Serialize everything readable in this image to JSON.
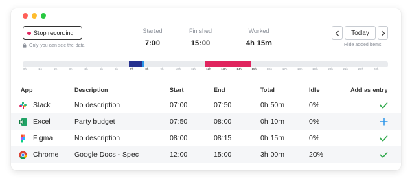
{
  "window_controls": [
    "close",
    "minimize",
    "maximize"
  ],
  "recording": {
    "stop_label": "Stop recording",
    "private_note": "Only you can see the data"
  },
  "stats": {
    "started": {
      "label": "Started",
      "value": "7:00"
    },
    "finished": {
      "label": "Finished",
      "value": "15:00"
    },
    "worked": {
      "label": "Worked",
      "value": "4h 15m"
    }
  },
  "date_nav": {
    "prev_icon": "chevron-left-icon",
    "today_label": "Today",
    "next_icon": "chevron-right-icon",
    "hide_added_label": "Hide added items"
  },
  "timeline": {
    "range_hours": [
      0,
      24
    ],
    "ticks": [
      "0h",
      "1h",
      "2h",
      "3h",
      "4h",
      "5h",
      "6h",
      "7h",
      "8h",
      "9h",
      "10h",
      "11h",
      "12h",
      "13h",
      "14h",
      "15h",
      "16h",
      "17h",
      "18h",
      "19h",
      "20h",
      "21h",
      "22h",
      "23h"
    ],
    "active_ticks": [
      "7h",
      "8h",
      "12h",
      "13h",
      "14h",
      "15h"
    ],
    "segments": [
      {
        "start_hour": 7.0,
        "end_hour": 7.83,
        "color": "#26318f"
      },
      {
        "start_hour": 7.83,
        "end_hour": 8.0,
        "color": "#2b95e9"
      },
      {
        "start_hour": 12.0,
        "end_hour": 15.0,
        "color": "#e0245e"
      }
    ]
  },
  "table": {
    "headers": {
      "app": "App",
      "description": "Description",
      "start": "Start",
      "end": "End",
      "total": "Total",
      "idle": "Idle",
      "add": "Add as entry"
    },
    "rows": [
      {
        "app": "Slack",
        "icon": "slack-icon",
        "description": "No description",
        "start": "07:00",
        "end": "07:50",
        "total": "0h 50m",
        "idle": "0%",
        "action": "check-icon"
      },
      {
        "app": "Excel",
        "icon": "excel-icon",
        "description": "Party budget",
        "start": "07:50",
        "end": "08:00",
        "total": "0h 10m",
        "idle": "0%",
        "action": "plus-icon"
      },
      {
        "app": "Figma",
        "icon": "figma-icon",
        "description": "No description",
        "start": "08:00",
        "end": "08:15",
        "total": "0h 15m",
        "idle": "0%",
        "action": "check-icon"
      },
      {
        "app": "Chrome",
        "icon": "chrome-icon",
        "description": "Google Docs - Spec",
        "start": "12:00",
        "end": "15:00",
        "total": "3h 00m",
        "idle": "20%",
        "action": "check-icon"
      }
    ]
  },
  "colors": {
    "check": "#2ea84a",
    "plus": "#2b95e9",
    "record": "#e0245e"
  }
}
